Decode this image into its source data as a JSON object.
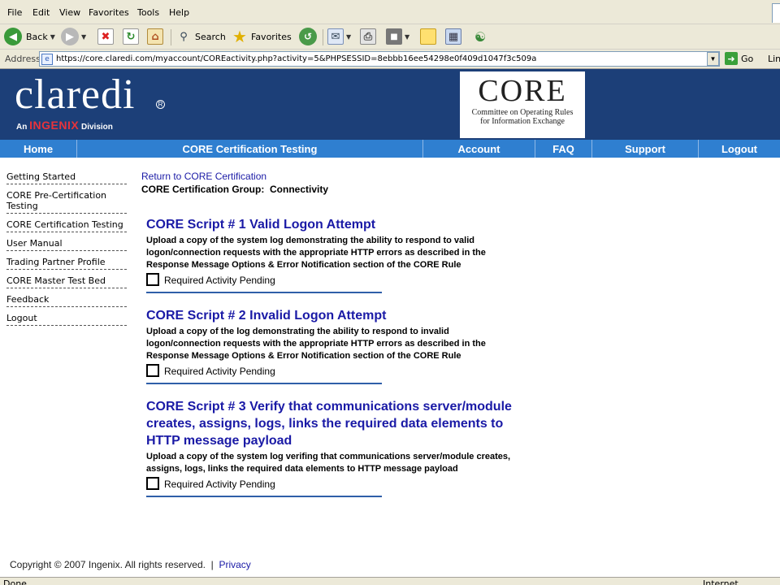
{
  "browser": {
    "menu": [
      "File",
      "Edit",
      "View",
      "Favorites",
      "Tools",
      "Help"
    ],
    "toolbar": {
      "back": "Back",
      "search": "Search",
      "favorites": "Favorites"
    },
    "address_label": "Address",
    "url": "https://core.claredi.com/myaccount/COREactivity.php?activity=5&PHPSESSID=8ebbb16ee54298e0f409d1047f3c509a",
    "go": "Go",
    "links": "Lin",
    "status": "Done",
    "zone": "Internet",
    "colors": {
      "chrome": "#ece9d8"
    }
  },
  "header": {
    "logo": "claredi",
    "tagline_prefix": "An",
    "tagline_brand": "INGENIX",
    "tagline_suffix": "Division",
    "core_logo": "CORE",
    "core_sub_line1": "Committee on Operating Rules",
    "core_sub_line2": "for Information Exchange",
    "colors": {
      "header_bg": "#1c3f78",
      "nav_bg": "#2f7fd0",
      "brand_red": "#e8333b"
    }
  },
  "nav": [
    "Home",
    "CORE Certification Testing",
    "Account",
    "FAQ",
    "Support",
    "Logout"
  ],
  "sidebar": [
    "Getting Started",
    "CORE Pre-Certification Testing",
    "CORE Certification Testing",
    "User Manual",
    "Trading Partner Profile",
    "CORE Master Test Bed",
    "Feedback",
    "Logout"
  ],
  "main": {
    "return_link": "Return to CORE Certification",
    "group_label": "CORE Certification Group:",
    "group_value": "Connectivity",
    "scripts": [
      {
        "title": "CORE Script # 1 Valid Logon Attempt",
        "desc": "Upload a copy of the system log demonstrating the ability to respond to valid logon/connection requests with the appropriate HTTP errors as described in the Response Message Options & Error Notification section of the CORE Rule",
        "status": "Required Activity Pending"
      },
      {
        "title": "CORE Script # 2 Invalid Logon Attempt",
        "desc": "Upload a copy of the log demonstrating the ability to respond to invalid logon/connection requests with the appropriate HTTP errors as described in the Response Message Options & Error Notification section of the CORE Rule",
        "status": "Required Activity Pending"
      },
      {
        "title": "CORE Script # 3 Verify that communications server/module creates, assigns, logs, links the required data elements to HTTP message payload",
        "desc": "Upload a copy of the system log verifing that communications server/module creates, assigns, logs, links the required data elements to HTTP message payload",
        "status": "Required Activity Pending"
      }
    ]
  },
  "footer": {
    "copyright": "Copyright © 2007 Ingenix. All rights reserved.",
    "separator": "|",
    "privacy": "Privacy"
  }
}
